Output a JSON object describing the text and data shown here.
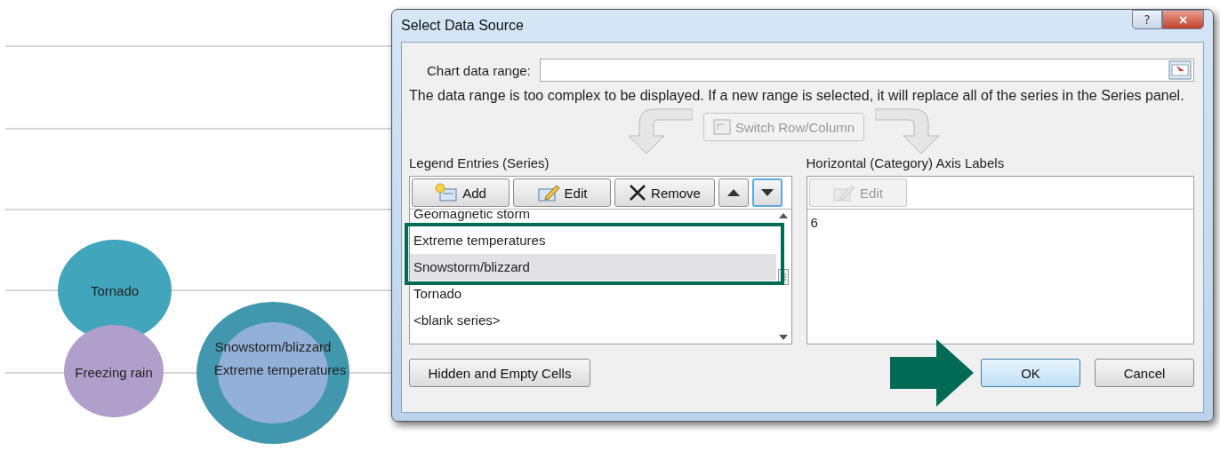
{
  "chart": {
    "bubbles": [
      {
        "label": "Tornado",
        "color": "#41a5bc"
      },
      {
        "label": "Freezing rain",
        "color": "#b09fca"
      },
      {
        "label": "Snowstorm/blizzard",
        "color": "#4197ad"
      },
      {
        "label": "Extreme temperatures",
        "color": "#93b1d8"
      }
    ]
  },
  "dialog": {
    "title": "Select Data Source",
    "help_button": "?",
    "close_button": "×",
    "data_range": {
      "label": "Chart data range:"
    },
    "message": "The data range is too complex to be displayed. If a new range is selected, it will replace all of the series in the Series panel.",
    "switch_button": {
      "label": "Switch Row/Column",
      "disabled": true
    },
    "series_panel": {
      "title": "Legend Entries (Series)",
      "buttons": [
        {
          "kind": "add",
          "label": "Add"
        },
        {
          "kind": "edit",
          "label": "Edit"
        },
        {
          "kind": "remove",
          "label": "Remove"
        },
        {
          "kind": "up"
        },
        {
          "kind": "down"
        }
      ],
      "items": [
        {
          "label": "Geomagnetic storm",
          "selected": false,
          "highlighted": false
        },
        {
          "label": "Extreme temperatures",
          "selected": false,
          "highlighted": true
        },
        {
          "label": "Snowstorm/blizzard",
          "selected": true,
          "highlighted": true
        },
        {
          "label": "Tornado",
          "selected": false,
          "highlighted": false
        },
        {
          "label": "<blank series>",
          "selected": false,
          "highlighted": false
        }
      ]
    },
    "axis_panel": {
      "title": "Horizontal (Category) Axis Labels",
      "edit_button": {
        "label": "Edit",
        "disabled": true
      },
      "items": [
        "6"
      ]
    },
    "hidden_cells_button": "Hidden and Empty Cells",
    "ok_button": {
      "label": "OK",
      "pointer_arrow": true
    },
    "cancel_button": "Cancel"
  }
}
